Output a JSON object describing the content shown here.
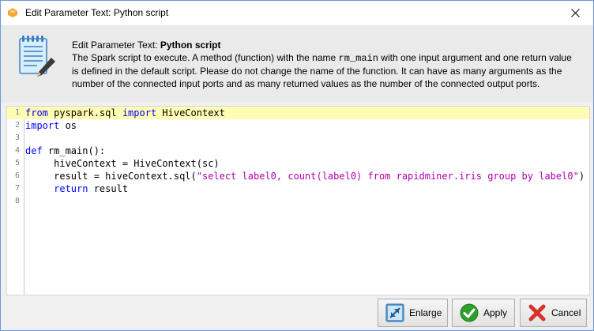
{
  "window": {
    "title": "Edit Parameter Text: Python script",
    "close_icon": "close-icon"
  },
  "header": {
    "icon": "notepad-pencil-icon",
    "heading_prefix": "Edit Parameter Text: ",
    "heading_bold": "Python script",
    "desc_part1": "The Spark script to execute. A method (function) with the name ",
    "desc_code": "rm_main",
    "desc_part2": " with one input argument and one return value is defined in the default script. Please do not change the name of the function. It can have as many arguments as the number of the connected input ports and as many returned values as the number of the connected output ports."
  },
  "editor": {
    "current_line": 1,
    "lines": [
      {
        "num": "1",
        "tokens": [
          [
            "kw",
            "from"
          ],
          [
            "plain",
            " pyspark.sql "
          ],
          [
            "kw",
            "import"
          ],
          [
            "plain",
            " HiveContext"
          ]
        ]
      },
      {
        "num": "2",
        "tokens": [
          [
            "kw",
            "import"
          ],
          [
            "plain",
            " os"
          ]
        ]
      },
      {
        "num": "3",
        "tokens": []
      },
      {
        "num": "4",
        "tokens": [
          [
            "kw",
            "def"
          ],
          [
            "plain",
            " rm_main():"
          ]
        ]
      },
      {
        "num": "5",
        "tokens": [
          [
            "plain",
            "     hiveContext = HiveContext(sc)"
          ]
        ]
      },
      {
        "num": "6",
        "tokens": [
          [
            "plain",
            "     result = hiveContext.sql("
          ],
          [
            "str",
            "\"select label0, count(label0) from rapidminer.iris group by label0\""
          ],
          [
            "plain",
            ")"
          ]
        ]
      },
      {
        "num": "7",
        "tokens": [
          [
            "plain",
            "     "
          ],
          [
            "kw",
            "return"
          ],
          [
            "plain",
            " result"
          ]
        ]
      },
      {
        "num": "8",
        "tokens": []
      }
    ]
  },
  "buttons": {
    "enlarge": {
      "label": "Enlarge",
      "icon": "enlarge-icon"
    },
    "apply": {
      "label": "Apply",
      "icon": "checkmark-icon"
    },
    "cancel": {
      "label": "Cancel",
      "icon": "x-icon"
    }
  },
  "colors": {
    "keyword": "#0000ff",
    "string": "#b000b0",
    "current_line_bg": "#fefdb3",
    "apply_green": "#2e9e2e",
    "cancel_red": "#d8322a"
  }
}
